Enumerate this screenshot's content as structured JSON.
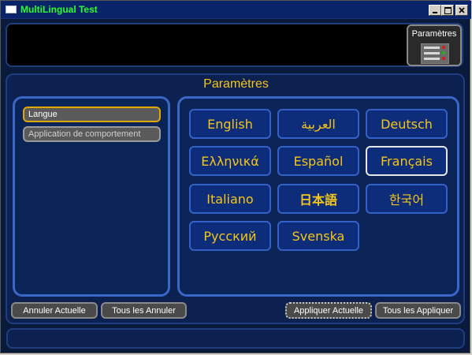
{
  "window": {
    "title": "MultiLingual Test",
    "title_color": "#2bff2b",
    "controls": [
      "minimize-icon",
      "maximize-icon",
      "close-icon"
    ]
  },
  "toolbar": {
    "params_label": "Paramètres",
    "params_icon": "settings-panel-icon"
  },
  "panel": {
    "title": "Paramètres",
    "accent": "#f5c518"
  },
  "categories": [
    {
      "label": "Langue",
      "selected": true
    },
    {
      "label": "Application de comportement",
      "selected": false
    }
  ],
  "languages": [
    {
      "label": "English"
    },
    {
      "label": "العربية"
    },
    {
      "label": "Deutsch"
    },
    {
      "label": "Ελληνικά"
    },
    {
      "label": "Español"
    },
    {
      "label": "Français",
      "selected": true
    },
    {
      "label": "Italiano"
    },
    {
      "label": "日本語"
    },
    {
      "label": "한국어"
    },
    {
      "label": "Русский"
    },
    {
      "label": "Svenska"
    }
  ],
  "actions": {
    "cancel_current": "Annuler Actuelle",
    "cancel_all": "Tous les Annuler",
    "apply_current": "Appliquer Actuelle",
    "apply_all": "Tous les Appliquer"
  },
  "status": {
    "text": ""
  }
}
